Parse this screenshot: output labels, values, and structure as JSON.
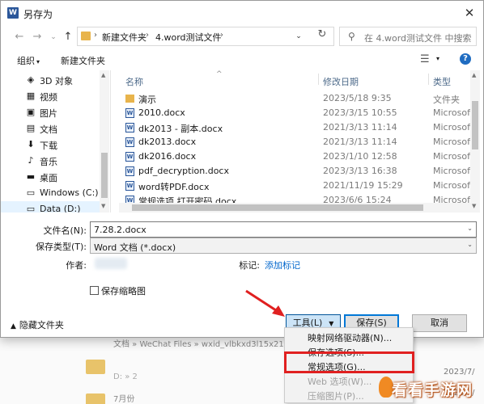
{
  "window": {
    "title": "另存为",
    "app_icon_letter": "W"
  },
  "address": {
    "crumbs": [
      "新建文件夹",
      "4.word测试文件"
    ],
    "search_placeholder": "在 4.word测试文件 中搜索"
  },
  "toolbar": {
    "organize": "组织",
    "new_folder": "新建文件夹"
  },
  "nav": {
    "items": [
      {
        "icon": "3d-objects-icon",
        "glyph": "◈",
        "label": "3D 对象"
      },
      {
        "icon": "video-icon",
        "glyph": "▦",
        "label": "视频"
      },
      {
        "icon": "pictures-icon",
        "glyph": "▣",
        "label": "图片"
      },
      {
        "icon": "documents-icon",
        "glyph": "▤",
        "label": "文档"
      },
      {
        "icon": "download-icon",
        "glyph": "⬇",
        "label": "下载"
      },
      {
        "icon": "music-icon",
        "glyph": "♪",
        "label": "音乐"
      },
      {
        "icon": "desktop-icon",
        "glyph": "▬",
        "label": "桌面"
      },
      {
        "icon": "drive-icon",
        "glyph": "▭",
        "label": "Windows (C:)"
      },
      {
        "icon": "drive-icon",
        "glyph": "▭",
        "label": "Data (D:)"
      }
    ],
    "selected_index": 8
  },
  "columns": {
    "name": "名称",
    "date": "修改日期",
    "type": "类型"
  },
  "files": [
    {
      "name": "演示",
      "date": "2023/5/18 9:35",
      "type": "文件夹",
      "kind": "folder"
    },
    {
      "name": "2010.docx",
      "date": "2023/3/15 10:55",
      "type": "Microsoft",
      "kind": "docx"
    },
    {
      "name": "dk2013 - 副本.docx",
      "date": "2021/3/13 11:14",
      "type": "Microsoft",
      "kind": "docx"
    },
    {
      "name": "dk2013.docx",
      "date": "2021/3/13 11:14",
      "type": "Microsoft",
      "kind": "docx"
    },
    {
      "name": "dk2016.docx",
      "date": "2023/1/10 12:58",
      "type": "Microsoft",
      "kind": "docx"
    },
    {
      "name": "pdf_decryption.docx",
      "date": "2023/3/13 16:38",
      "type": "Microsoft",
      "kind": "docx"
    },
    {
      "name": "word转PDF.docx",
      "date": "2021/11/19 15:29",
      "type": "Microsoft",
      "kind": "docx"
    },
    {
      "name": "常规选项 打开密码.docx",
      "date": "2023/6/6 15:24",
      "type": "Microsoft",
      "kind": "docx"
    }
  ],
  "form": {
    "filename_label": "文件名(N):",
    "filename_value": "7.28.2.docx",
    "filetype_label": "保存类型(T):",
    "filetype_value": "Word 文档 (*.docx)",
    "author_label": "作者:",
    "tags_label": "标记:",
    "tags_link": "添加标记",
    "thumbnail_label": "保存缩略图"
  },
  "footer": {
    "hide_folders": "隐藏文件夹",
    "tools": "工具(L)",
    "save": "保存(S)",
    "cancel": "取消"
  },
  "tools_menu": [
    {
      "label": "映射网络驱动器(N)...",
      "enabled": true
    },
    {
      "label": "保存选项(S)...",
      "enabled": true
    },
    {
      "label": "常规选项(G)...",
      "enabled": true
    },
    {
      "label": "Web 选项(W)...",
      "enabled": false
    },
    {
      "label": "压缩图片(P)...",
      "enabled": false
    }
  ],
  "background": {
    "row1": "文档 » WeChat Files » wxid_vlbkxd3l15x21 »",
    "row1_sub": "D: » 2",
    "row2_sub": "2",
    "row3": "7月份",
    "date1": "2023/7/",
    "date2": "2023/7/"
  },
  "watermark": "看看手游网",
  "colors": {
    "accent": "#0078d7",
    "annotation_red": "#e02020",
    "word_blue": "#2b579a"
  }
}
